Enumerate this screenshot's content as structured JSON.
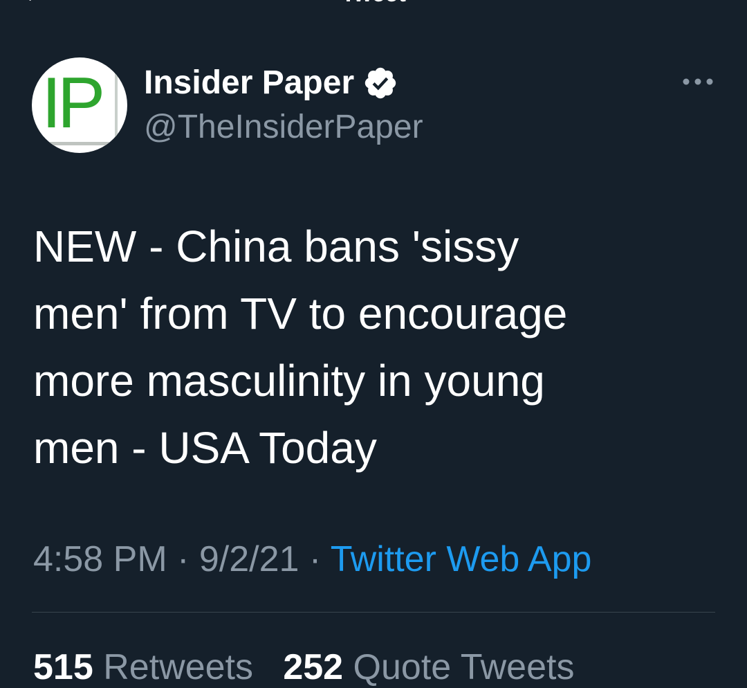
{
  "header": {
    "back_icon": "back-arrow-icon",
    "title": "Tweet"
  },
  "author": {
    "avatar_text": "IP",
    "display_name": "Insider Paper",
    "handle": "@TheInsiderPaper",
    "verified_icon": "verified-badge-icon",
    "more_icon": "more-options-icon"
  },
  "tweet": {
    "lines": [
      "NEW - China bans 'sissy",
      "men' from TV to encourage",
      "more masculinity in young",
      "men - USA Today"
    ]
  },
  "meta": {
    "time": "4:58 PM",
    "separator": "·",
    "date": "9/2/21",
    "source": "Twitter Web App"
  },
  "stats": {
    "retweets_count": "515",
    "retweets_label": "Retweets",
    "quotes_count": "252",
    "quotes_label": "Quote Tweets"
  },
  "colors": {
    "background": "#15202b",
    "secondary_text": "#8b98a5",
    "link": "#1d9bf0",
    "avatar_green": "#2ea52e"
  }
}
